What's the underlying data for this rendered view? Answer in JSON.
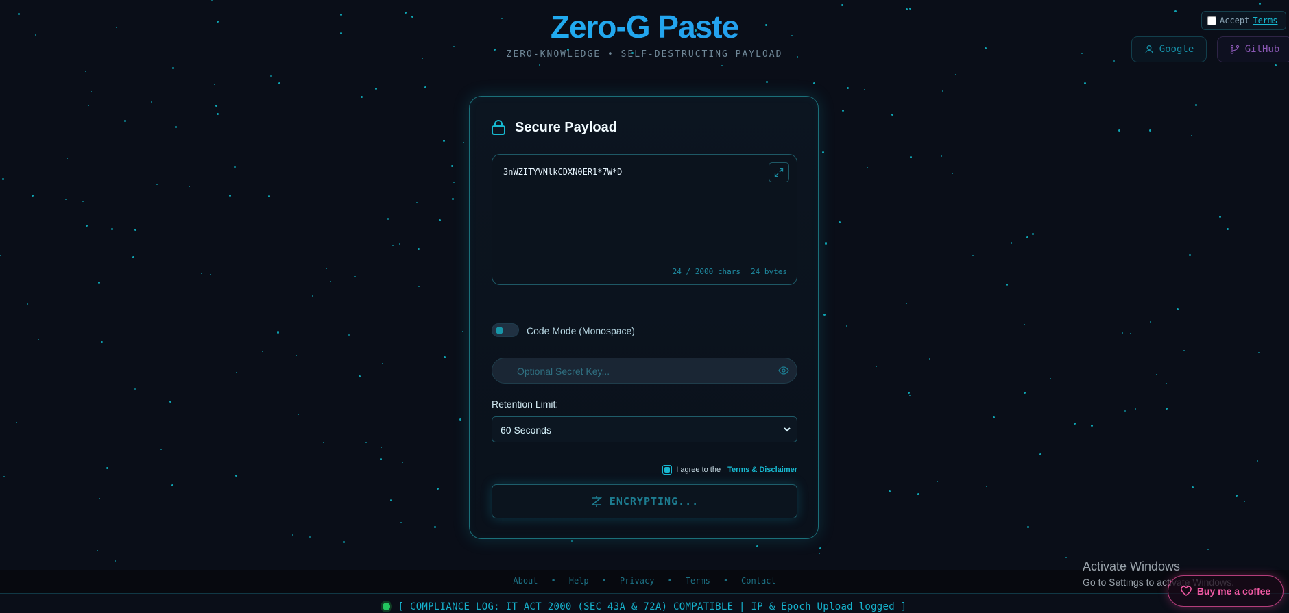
{
  "header": {
    "title": "Zero-G Paste",
    "subtitle": "ZERO-KNOWLEDGE • SELF-DESTRUCTING PAYLOAD"
  },
  "top_right": {
    "accept_label": "Accept",
    "terms_link": "Terms",
    "google_label": "Google",
    "github_label": "GitHub"
  },
  "card": {
    "title": "Secure Payload",
    "payload_text": "3nWZITYVNlkCDXN0ER1*7W*D",
    "char_count": "24 / 2000 chars",
    "byte_count": "24 bytes",
    "code_mode_label": "Code Mode (Monospace)",
    "code_mode_on": false,
    "secret_placeholder": "Optional Secret Key...",
    "retention_label": "Retention Limit:",
    "retention_value": "60 Seconds",
    "agree_text": "I agree to the",
    "agree_link": "Terms & Disclaimer",
    "agree_checked": true,
    "encrypt_label": "ENCRYPTING..."
  },
  "footer": {
    "links": [
      "About",
      "Help",
      "Privacy",
      "Terms",
      "Contact"
    ],
    "compliance": "[ COMPLIANCE LOG: IT ACT 2000 (SEC 43A & 72A) COMPATIBLE | IP & Epoch Upload logged ]"
  },
  "overlay": {
    "activate_title": "Activate Windows",
    "activate_sub": "Go to Settings to activate Windows.",
    "coffee_label": "Buy me a coffee"
  },
  "colors": {
    "background": "#0a0e18",
    "accent": "#17b9d0",
    "title_gradient_start": "#16c6f0",
    "title_gradient_end": "#2f86ee",
    "status": "#22c55e",
    "coffee": "#f25aa5"
  }
}
